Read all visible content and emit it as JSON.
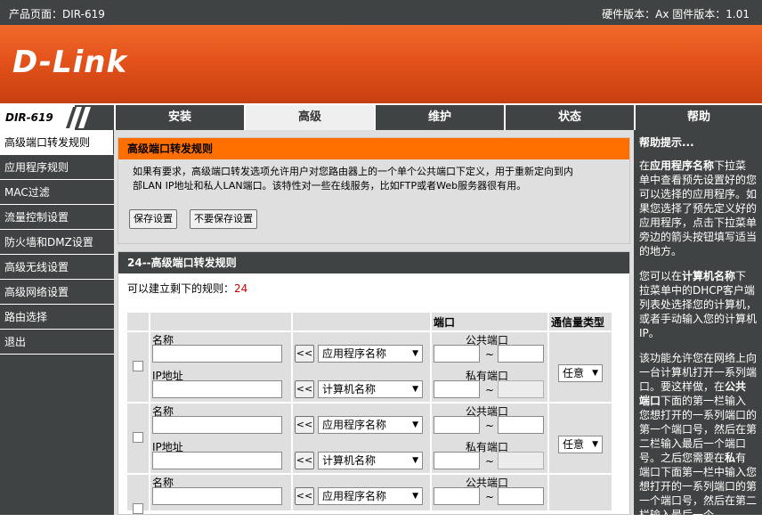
{
  "topbar": {
    "product_page": "产品页面：DIR-619",
    "versions": "硬件版本：Ax   固件版本：1.01"
  },
  "brand": {
    "logo": "D-Link"
  },
  "nav": {
    "model": "DIR-619",
    "tabs": [
      "安装",
      "高级",
      "维护",
      "状态",
      "帮助"
    ],
    "active_tab": "高级"
  },
  "sidebar": {
    "items": [
      "高级端口转发规则",
      "应用程序规则",
      "MAC过滤",
      "流量控制设置",
      "防火墙和DMZ设置",
      "高级无线设置",
      "高级网络设置",
      "路由选择",
      "退出"
    ],
    "active": "高级端口转发规则"
  },
  "section1": {
    "title": "高级端口转发规则",
    "desc1": "如果有要求，高级端口转发选项允许用户对您路由器上的一个单个公共端口下定义，用于重新定向到内",
    "desc2": "部LAN IP地址和私人LAN端口。该特性对一些在线服务，比如FTP或者Web服务器很有用。",
    "save_label": "保存设置",
    "nosave_label": "不要保存设置"
  },
  "section2": {
    "title": "24--高级端口转发规则",
    "remaining_label": "可以建立剩下的规则：",
    "remaining_count": "24",
    "headers": {
      "port": "端口",
      "protocol": "通信量类型"
    },
    "labels": {
      "name": "名称",
      "ip": "IP地址",
      "public_port": "公共端口",
      "private_port": "私有端口",
      "tilde": "~",
      "arrow": "<<",
      "app_select": "应用程序名称",
      "pc_select": "计算机名称",
      "protocol_value": "任意"
    }
  },
  "help": {
    "title": "帮助提示...",
    "p1_before": "在",
    "p1_bold": "应用程序名称",
    "p1_after": "下拉菜单中查看预先设置好的您可以选择的应用程序。如果您选择了预先定义好的应用程序，点击下拉菜单旁边的箭头按钮填写适当的地方。",
    "p2_before": "您可以在",
    "p2_bold": "计算机名称",
    "p2_after": "下拉菜单中的DHCP客户端列表处选择您的计算机，或者手动输入您的计算机IP。",
    "p3_before": "该功能允许您在网络上向一台计算机打开一系列端口。要这样做，在",
    "p3_bold": "公共端口",
    "p3_mid": "下面的第一栏输入您想打开的一系列端口的第一个端口号，然后在第二栏输入最后一个端口号。之后您需要在",
    "p3_bold2": "私",
    "p3_after": "有端口下面第一栏中输入您想打开的一系列端口的第一个端口号，然后在第二栏输入最后一个。"
  },
  "colors": {
    "accent": "#ff6f00",
    "dark": "#404343",
    "banner": "#e4521b"
  }
}
